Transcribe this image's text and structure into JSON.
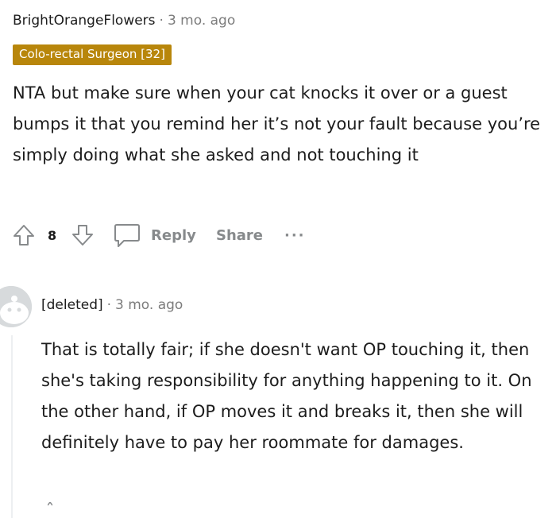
{
  "comment1": {
    "username": "BrightOrangeFlowers",
    "separator": "·",
    "time": "3 mo. ago",
    "flair": "Colo-rectal Surgeon [32]",
    "flair_color": "#b8860b",
    "body": "NTA but make sure when your cat knocks it over or a guest bumps it that you remind her it’s not your fault because you’re simply doing what she asked and not touching it",
    "votes": "8",
    "reply_label": "Reply",
    "share_label": "Share",
    "more_label": "···",
    "icons": [
      "upvote-icon",
      "downvote-icon",
      "comment-icon"
    ]
  },
  "comment2": {
    "username": "[deleted]",
    "separator": "·",
    "time": "3 mo. ago",
    "body": "That is totally fair; if she doesn't want OP touching it, then she's taking responsibility for anything happening to it. On the other hand, if OP moves it and breaks it, then she will definitely have to pay her roommate for damages.",
    "icons": [
      "avatar-icon"
    ]
  },
  "colors": {
    "text": "#1c1c1c",
    "meta": "#7c7c7c",
    "action": "#878a8c",
    "thread_line": "#edeff1"
  }
}
